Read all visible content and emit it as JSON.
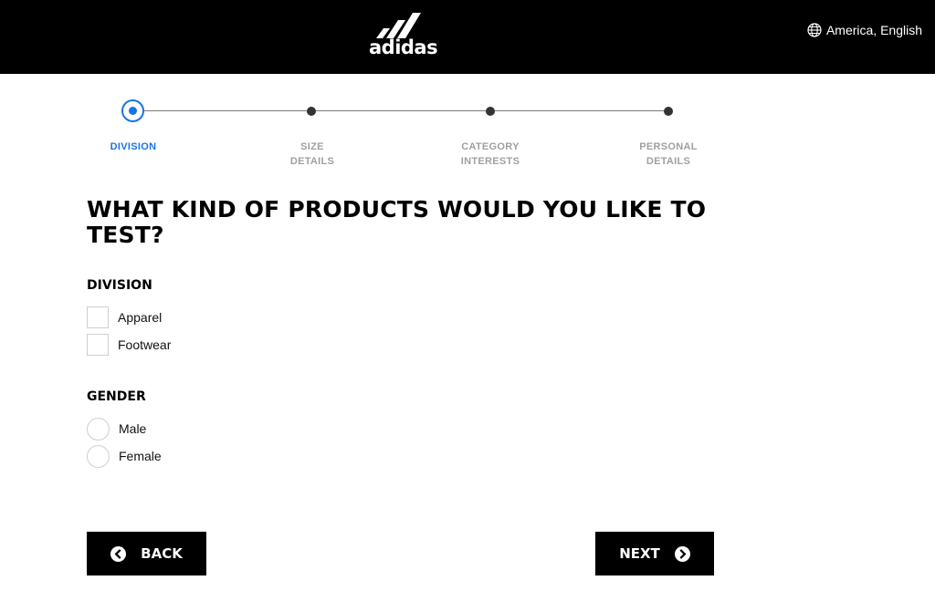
{
  "header": {
    "logo_text": "adidas",
    "locale_label": "America, English"
  },
  "stepper": {
    "steps": [
      {
        "line1": "DIVISION",
        "line2": "",
        "active": true
      },
      {
        "line1": "SIZE",
        "line2": "DETAILS",
        "active": false
      },
      {
        "line1": "CATEGORY",
        "line2": "INTERESTS",
        "active": false
      },
      {
        "line1": "PERSONAL",
        "line2": "DETAILS",
        "active": false
      }
    ]
  },
  "form": {
    "question_line1": "WHAT KIND OF PRODUCTS WOULD YOU LIKE TO",
    "question_line2": "TEST?",
    "division": {
      "title": "DIVISION",
      "options": [
        "Apparel",
        "Footwear"
      ]
    },
    "gender": {
      "title": "GENDER",
      "options": [
        "Male",
        "Female"
      ]
    }
  },
  "buttons": {
    "back": "BACK",
    "next": "NEXT"
  },
  "colors": {
    "accent": "#1a73e8",
    "header_bg": "#000000",
    "button_bg": "#000000"
  },
  "icons": {
    "locale": "globe-icon",
    "back": "arrow-left-circle-icon",
    "next": "arrow-right-circle-icon"
  }
}
